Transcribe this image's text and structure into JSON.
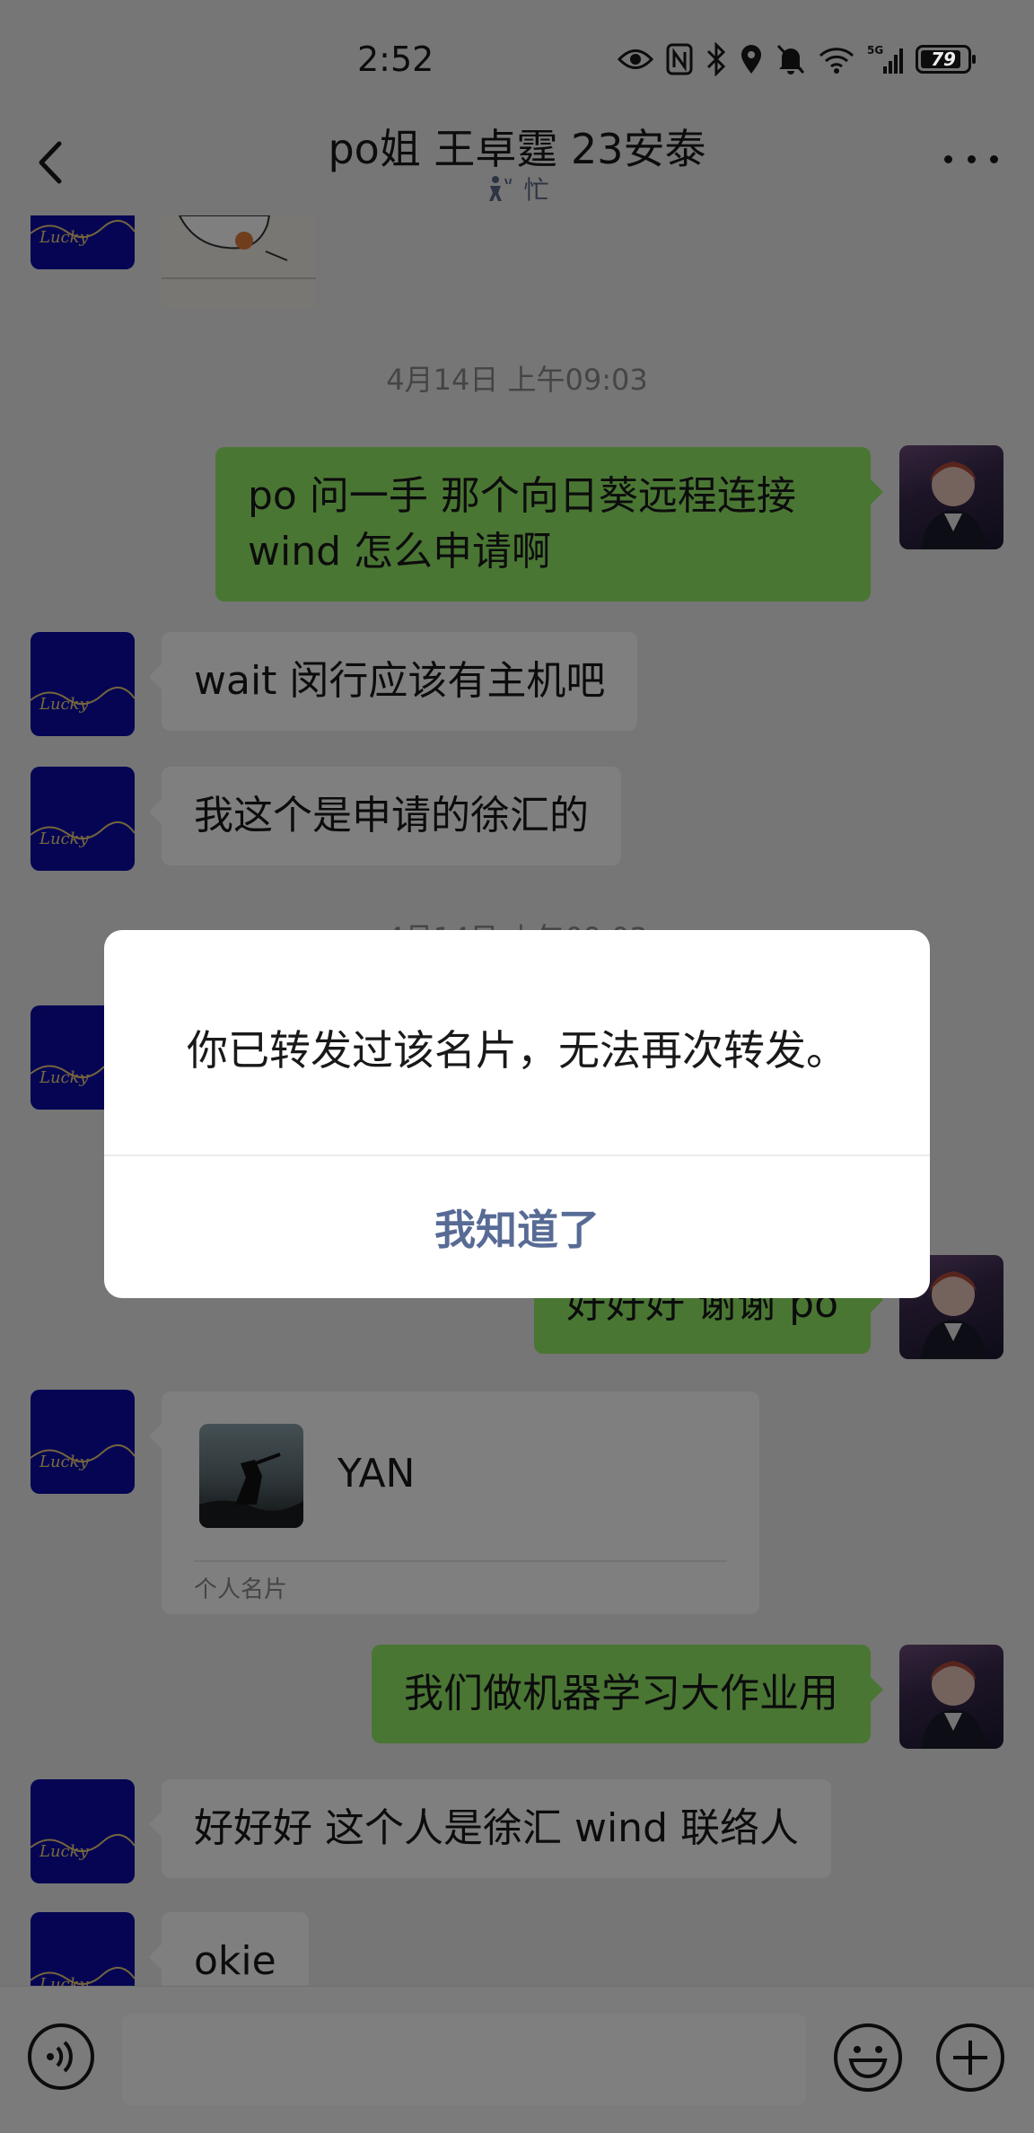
{
  "status_bar": {
    "time": "2:52",
    "battery": "79"
  },
  "header": {
    "title": "po姐 王卓霆 23安泰",
    "status_text": "忙"
  },
  "chat": {
    "timestamps": [
      "4月14日 上午09:03",
      "4月14日 上午09:03"
    ],
    "messages": [
      {
        "side": "out",
        "text": "po 问一手 那个向日葵远程连接 wind 怎么申请啊"
      },
      {
        "side": "in",
        "text": "wait 闵行应该有主机吧"
      },
      {
        "side": "in",
        "text": "我这个是申请的徐汇的"
      },
      {
        "side": "out",
        "text": "好好好 谢谢 po"
      },
      {
        "side": "out",
        "text": "我们做机器学习大作业用"
      },
      {
        "side": "in",
        "text": "好好好 这个人是徐汇 wind 联络人"
      },
      {
        "side": "in",
        "text": "okie"
      }
    ],
    "contact_card": {
      "name": "YAN",
      "type_label": "个人名片"
    },
    "avatar_text": "Lucky"
  },
  "dialog": {
    "message": "你已转发过该名片，无法再次转发。",
    "confirm_label": "我知道了"
  },
  "colors": {
    "outgoing_bubble": "#95ec69",
    "incoming_bubble": "#ffffff",
    "background": "#ededed",
    "dialog_button": "#576b95",
    "lucky_avatar": "#0a0aa8"
  }
}
